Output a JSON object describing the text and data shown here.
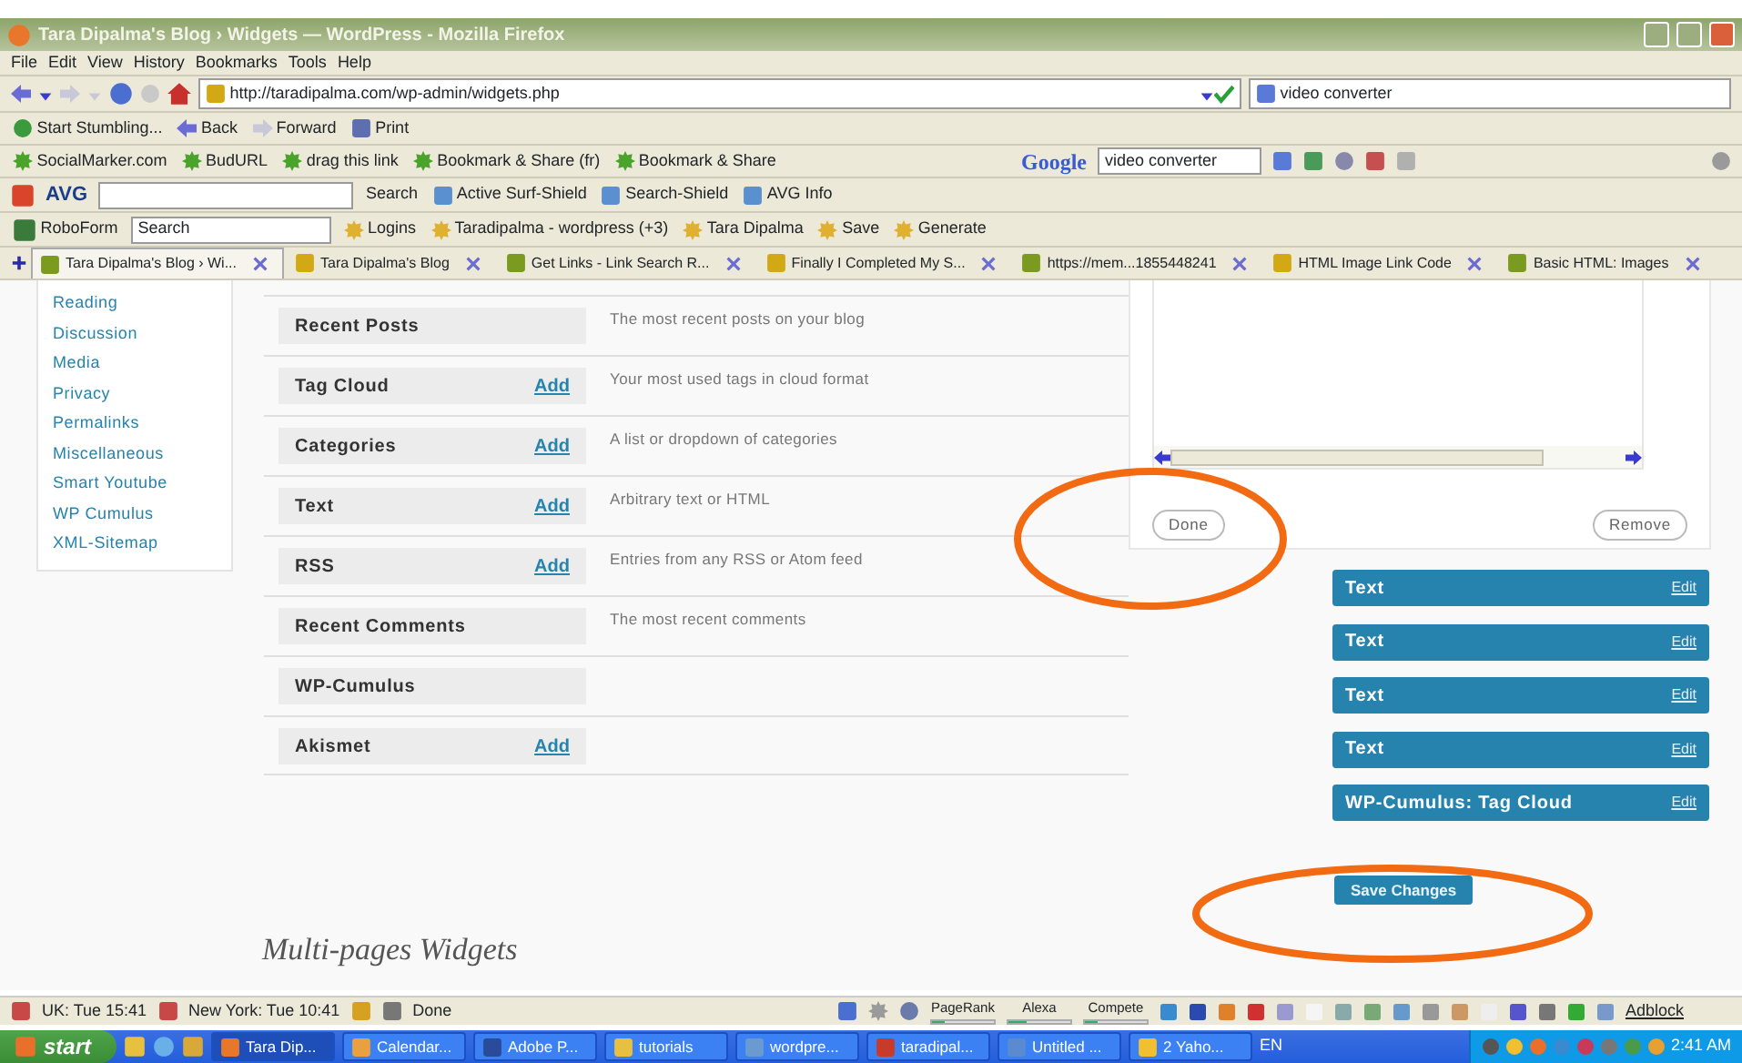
{
  "window": {
    "title": "Tara Dipalma's Blog › Widgets — WordPress - Mozilla Firefox"
  },
  "menu": [
    "File",
    "Edit",
    "View",
    "History",
    "Bookmarks",
    "Tools",
    "Help"
  ],
  "address": {
    "url": "http://taradipalma.com/wp-admin/widgets.php",
    "search": "video converter"
  },
  "stumble_bar": [
    "Start Stumbling...",
    "Back",
    "Forward",
    "Print"
  ],
  "bookmarks_bar": {
    "items": [
      "SocialMarker.com",
      "BudURL",
      "drag this link",
      "Bookmark & Share (fr)",
      "Bookmark & Share"
    ],
    "google_logo": "Google",
    "google_search": "video converter"
  },
  "avg_bar": {
    "logo": "AVG",
    "items": [
      "Search",
      "Active Surf-Shield",
      "Search-Shield",
      "AVG Info"
    ]
  },
  "roboform_bar": {
    "logo": "RoboForm",
    "search": "Search",
    "items": [
      "Logins",
      "Taradipalma - wordpress (+3)",
      "Tara Dipalma",
      "Save",
      "Generate"
    ]
  },
  "tabs": [
    {
      "label": "Tara Dipalma's Blog › Wi...",
      "selected": true
    },
    {
      "label": "Tara Dipalma's Blog",
      "selected": false
    },
    {
      "label": "Get Links - Link Search R...",
      "selected": false
    },
    {
      "label": "Finally I Completed My S...",
      "selected": false
    },
    {
      "label": "https://mem...1855448241",
      "selected": false
    },
    {
      "label": "HTML Image Link Code",
      "selected": false
    },
    {
      "label": "Basic HTML: Images",
      "selected": false
    }
  ],
  "settings_menu": [
    "Reading",
    "Discussion",
    "Media",
    "Privacy",
    "Permalinks",
    "Miscellaneous",
    "Smart Youtube",
    "WP Cumulus",
    "XML-Sitemap"
  ],
  "available_widgets": [
    {
      "name": "Recent Posts",
      "description": "The most recent posts on your blog"
    },
    {
      "name": "Tag Cloud",
      "action": "Add",
      "description": "Your most used tags in cloud format"
    },
    {
      "name": "Categories",
      "action": "Add",
      "description": "A list or dropdown of categories"
    },
    {
      "name": "Text",
      "action": "Add",
      "description": "Arbitrary text or HTML"
    },
    {
      "name": "RSS",
      "action": "Add",
      "description": "Entries from any RSS or Atom feed"
    },
    {
      "name": "Recent Comments",
      "description": "The most recent comments"
    },
    {
      "name": "WP-Cumulus"
    },
    {
      "name": "Akismet",
      "action": "Add"
    }
  ],
  "widget_form": {
    "buttons": [
      "Done",
      "Remove"
    ]
  },
  "current_widgets": [
    {
      "title": "Text",
      "action": "Edit"
    },
    {
      "title": "Text",
      "action": "Edit"
    },
    {
      "title": "Text",
      "action": "Edit"
    },
    {
      "title": "Text",
      "action": "Edit"
    },
    {
      "title": "WP-Cumulus: Tag Cloud",
      "action": "Edit"
    }
  ],
  "save_button": "Save Changes",
  "section_heading": "Multi-pages Widgets",
  "status_bar": {
    "clocks": [
      "UK: Tue 15:41",
      "New York: Tue 10:41"
    ],
    "status": "Done",
    "meters": [
      {
        "label": "PageRank",
        "level": 0.2
      },
      {
        "label": "Alexa",
        "level": 0.3
      },
      {
        "label": "Compete",
        "level": 0.2
      }
    ],
    "adblock": "Adblock"
  },
  "taskbar": {
    "start": "start",
    "tasks": [
      {
        "label": "Tara Dip...",
        "selected": true
      },
      {
        "label": "Calendar...",
        "selected": false
      },
      {
        "label": "Adobe P...",
        "selected": false
      },
      {
        "label": "tutorials",
        "selected": false
      },
      {
        "label": "wordpre...",
        "selected": false
      },
      {
        "label": "taradipal...",
        "selected": false
      },
      {
        "label": "Untitled ...",
        "selected": false
      },
      {
        "label": "2 Yaho...",
        "selected": false
      }
    ],
    "language": "EN",
    "clock": "2:41 AM"
  }
}
